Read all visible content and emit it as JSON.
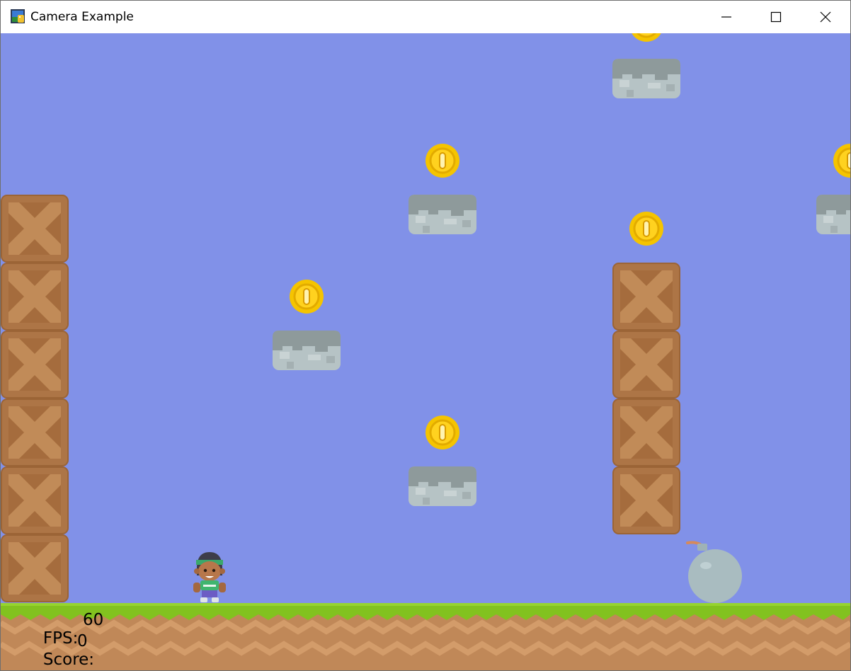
{
  "window": {
    "title": "Camera Example",
    "controls": [
      "minimize",
      "maximize",
      "close"
    ]
  },
  "hud": {
    "fps_label": "FPS:",
    "fps_value": "60",
    "score_label": "Score:",
    "score_value": "0"
  },
  "scene": {
    "sky_color": "#8191e8",
    "grass_color": "#82c21f",
    "dirt_color": "#c08858",
    "crate_color": "#b0794a",
    "coin_color": "#f5c400",
    "ledge_color": "#b7c4c6",
    "player": "player-character",
    "enemy": "bomb-enemy"
  }
}
